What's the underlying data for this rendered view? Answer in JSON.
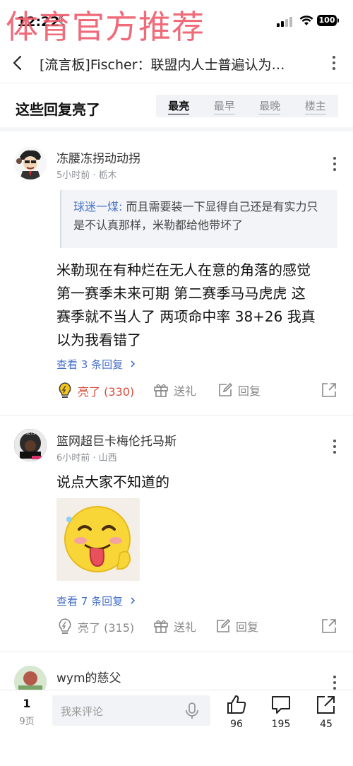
{
  "status": {
    "time": "12:22",
    "battery": "100"
  },
  "watermark": "体育官方推荐",
  "header": {
    "title": "[流言板]Fischer：联盟内人士普遍认为…"
  },
  "sort": {
    "heading": "这些回复亮了",
    "tabs": [
      "最亮",
      "最早",
      "最晚",
      "楼主"
    ],
    "active": "最亮"
  },
  "comments": [
    {
      "username": "冻腰冻拐动动拐",
      "meta": "5小时前 · 栃木",
      "quote": {
        "name": "球迷一煤:",
        "text": " 而且需要装一下显得自己还是有实力只是不认真那样，米勒都给他带坏了"
      },
      "body_lines": [
        "米勒现在有种烂在无人在意的角落的感觉",
        "第一赛季未来可期  第二赛季马马虎虎  这",
        "赛季就不当人了  两项命中率 38+26 我真",
        "以为我看错了"
      ],
      "view_replies": "查看 3 条回复",
      "like_label": "亮了 (330)",
      "gift_label": "送礼",
      "reply_label": "回复"
    },
    {
      "username": "篮网超巨卡梅伦托马斯",
      "meta": "6小时前 · 山西",
      "body_lines": [
        "说点大家不知道的"
      ],
      "view_replies": "查看 7 条回复",
      "like_label": "亮了 (315)",
      "gift_label": "送礼",
      "reply_label": "回复"
    },
    {
      "username": "wym的慈父"
    }
  ],
  "bottom_bar": {
    "page": "1",
    "total_pages": "9页",
    "input_placeholder": "我来评论",
    "likes": "96",
    "comments": "195",
    "shares": "45"
  },
  "colors": {
    "accent_blue": "#4570c9",
    "like_red": "#d64b3b",
    "watermark_pink": "#ef5b6b"
  }
}
